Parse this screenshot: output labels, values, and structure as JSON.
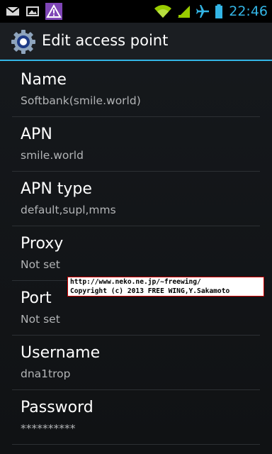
{
  "status_bar": {
    "left_icons": [
      "gmail-icon",
      "gallery-icon",
      "warning-icon"
    ],
    "right_icons": [
      "wifi-icon",
      "signal-icon",
      "airplane-mode-icon",
      "battery-icon"
    ],
    "time": "22:46",
    "accent_color": "#33b5e5"
  },
  "action_bar": {
    "icon": "settings-gear-icon",
    "title": "Edit access point"
  },
  "preferences": [
    {
      "title": "Name",
      "summary": "Softbank(smile.world)"
    },
    {
      "title": "APN",
      "summary": "smile.world"
    },
    {
      "title": "APN type",
      "summary": "default,supl,mms"
    },
    {
      "title": "Proxy",
      "summary": "Not set"
    },
    {
      "title": "Port",
      "summary": "Not set"
    },
    {
      "title": "Username",
      "summary": "dna1trop"
    },
    {
      "title": "Password",
      "summary": "**********"
    }
  ],
  "watermark": {
    "line1": "http://www.neko.ne.jp/~freewing/",
    "line2": "Copyright (c) 2013 FREE WING,Y.Sakamoto"
  }
}
